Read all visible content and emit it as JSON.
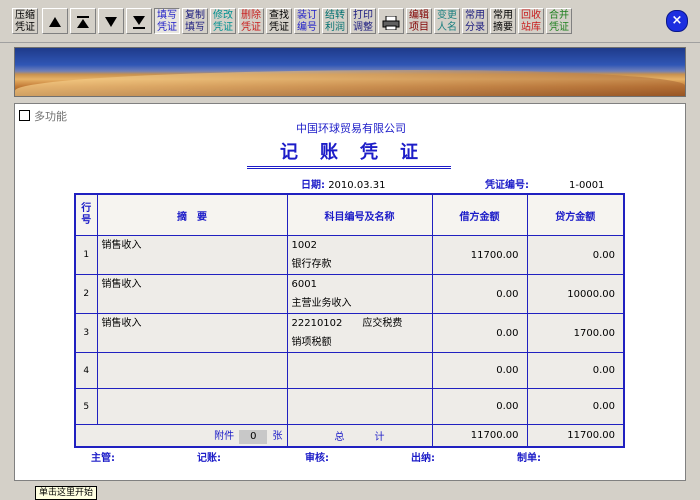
{
  "toolbar": {
    "buttons": [
      {
        "l1": "压缩",
        "l2": "凭证",
        "color": "#000000"
      },
      {
        "l1": "填写",
        "l2": "凭证",
        "color": "#1c1cc8"
      },
      {
        "l1": "复制",
        "l2": "填写",
        "color": "#1c1c80"
      },
      {
        "l1": "修改",
        "l2": "凭证",
        "color": "#009090"
      },
      {
        "l1": "删除",
        "l2": "凭证",
        "color": "#c81c1c"
      },
      {
        "l1": "查找",
        "l2": "凭证",
        "color": "#000000"
      },
      {
        "l1": "装订",
        "l2": "编号",
        "color": "#1c1cc8"
      },
      {
        "l1": "结转",
        "l2": "利润",
        "color": "#007070"
      },
      {
        "l1": "打印",
        "l2": "调整",
        "color": "#1c1c80"
      },
      {
        "l1": "编辑",
        "l2": "项目",
        "color": "#800000"
      },
      {
        "l1": "变更",
        "l2": "人名",
        "color": "#1c8080"
      },
      {
        "l1": "常用",
        "l2": "分录",
        "color": "#1c1c80"
      },
      {
        "l1": "常用",
        "l2": "摘要",
        "color": "#000000"
      },
      {
        "l1": "回收",
        "l2": "站库",
        "color": "#c81c1c"
      },
      {
        "l1": "合并",
        "l2": "凭证",
        "color": "#208020"
      }
    ],
    "close_glyph": "×"
  },
  "icons": [
    "triangle-up-icon",
    "triangle-up-bar-icon",
    "triangle-down-icon",
    "triangle-down-bar-icon",
    "printer-icon",
    "close-icon"
  ],
  "multi_label": "多功能",
  "company": "中国环球贸易有限公司",
  "title": "记账凭证",
  "date_label": "日期:",
  "date_value": "2010.03.31",
  "voucher_no_label": "凭证编号:",
  "voucher_no": "1-0001",
  "headers": {
    "idx": "行号",
    "summary": "摘　要",
    "account": "科目编号及名称",
    "debit": "借方金额",
    "credit": "贷方金额"
  },
  "rows": [
    {
      "idx": "1",
      "summary": "销售收入",
      "acc1": "1002",
      "acc2": "银行存款",
      "debit": "11700.00",
      "credit": "0.00"
    },
    {
      "idx": "2",
      "summary": "销售收入",
      "acc1": "6001",
      "acc2": "主营业务收入",
      "debit": "0.00",
      "credit": "10000.00"
    },
    {
      "idx": "3",
      "summary": "销售收入",
      "acc1": "22210102　　应交税费",
      "acc2": "销项税额",
      "debit": "0.00",
      "credit": "1700.00"
    },
    {
      "idx": "4",
      "summary": "",
      "acc1": "",
      "acc2": "",
      "debit": "0.00",
      "credit": "0.00"
    },
    {
      "idx": "5",
      "summary": "",
      "acc1": "",
      "acc2": "",
      "debit": "0.00",
      "credit": "0.00"
    }
  ],
  "footer": {
    "attach_label": "附件",
    "attach_count": "0",
    "attach_unit": "张",
    "total_label": "总　　　计",
    "debit_total": "11700.00",
    "credit_total": "11700.00"
  },
  "signers": [
    "主管:",
    "记账:",
    "审核:",
    "出纳:",
    "制单:"
  ],
  "status": {
    "start_hint": "单击这里开始"
  }
}
